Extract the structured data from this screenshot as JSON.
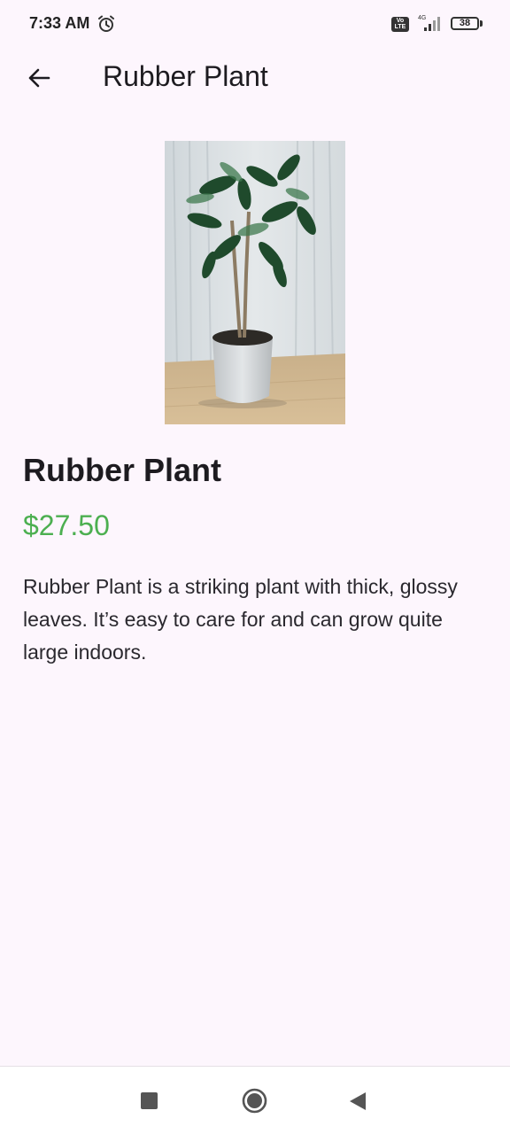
{
  "status_bar": {
    "time": "7:33 AM",
    "volte_label": "Vo LTE",
    "network_label": "4G",
    "battery_level": "38",
    "icons": [
      "alarm-icon",
      "volte-icon",
      "signal-icon",
      "battery-icon"
    ]
  },
  "app_bar": {
    "back_icon": "arrow-left-icon",
    "title": "Rubber Plant"
  },
  "product": {
    "image_icon": "rubber-plant-photo",
    "name": "Rubber Plant",
    "price": "$27.50",
    "description": "Rubber Plant is a striking plant with thick, glossy leaves. It’s easy to care for and can grow quite large indoors."
  },
  "nav_bar": {
    "icons": [
      "recents-square-icon",
      "home-circle-icon",
      "back-triangle-icon"
    ]
  },
  "colors": {
    "background": "#fdf6fd",
    "price": "#4caf50",
    "text": "#1d1b20"
  }
}
